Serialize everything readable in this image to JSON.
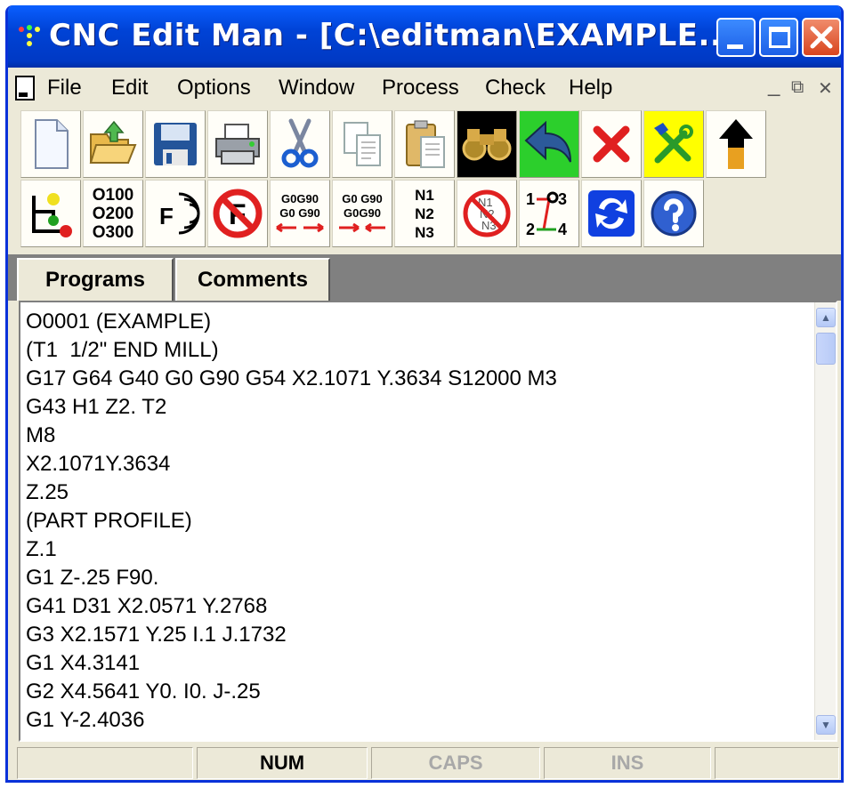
{
  "window": {
    "title": "CNC Edit Man - [C:\\editman\\EXAMPLE...."
  },
  "menu": {
    "items": [
      "File",
      "Edit",
      "Options",
      "Window",
      "Process",
      "Check",
      "Help"
    ]
  },
  "toolbar": {
    "row1": [
      {
        "name": "new-document-icon"
      },
      {
        "name": "open-folder-icon"
      },
      {
        "name": "save-disk-icon"
      },
      {
        "name": "print-icon"
      },
      {
        "name": "cut-scissors-icon"
      },
      {
        "name": "copy-icon"
      },
      {
        "name": "paste-icon"
      },
      {
        "name": "find-binoculars-icon"
      },
      {
        "name": "undo-arrow-icon"
      },
      {
        "name": "delete-x-icon"
      },
      {
        "name": "settings-tools-icon"
      },
      {
        "name": "pointer-pin-icon"
      }
    ],
    "row2_labels": {
      "program_numbers": [
        "O100",
        "O200",
        "O300"
      ],
      "feed_label": "F",
      "no_feed_label": "F",
      "g0g90_a": [
        "G0G90",
        "G0  G90"
      ],
      "g0g90_b": [
        "G0  G90",
        "G0G90"
      ],
      "n_numbers": [
        "N1",
        "N2",
        "N3"
      ],
      "n_numbers_removed": [
        "N1",
        "N2",
        "N3"
      ],
      "renumber_a": [
        "1",
        "3"
      ],
      "renumber_b": [
        "2",
        "4"
      ]
    }
  },
  "tabs": [
    "Programs",
    "Comments"
  ],
  "editor": {
    "lines": [
      "O0001 (EXAMPLE)",
      "(T1  1/2\" END MILL)",
      "G17 G64 G40 G0 G90 G54 X2.1071 Y.3634 S12000 M3",
      "G43 H1 Z2. T2",
      "M8",
      "X2.1071Y.3634",
      "Z.25",
      "(PART PROFILE)",
      "Z.1",
      "G1 Z-.25 F90.",
      "G41 D31 X2.0571 Y.2768",
      "G3 X2.1571 Y.25 I.1 J.1732",
      "G1 X4.3141",
      "G2 X4.5641 Y0. I0. J-.25",
      "G1 Y-2.4036"
    ]
  },
  "statusbar": {
    "num": "NUM",
    "caps": "CAPS",
    "ins": "INS"
  },
  "colors": {
    "title_blue": "#0043d6",
    "close_red": "#d8451e",
    "face": "#ece9d8"
  }
}
